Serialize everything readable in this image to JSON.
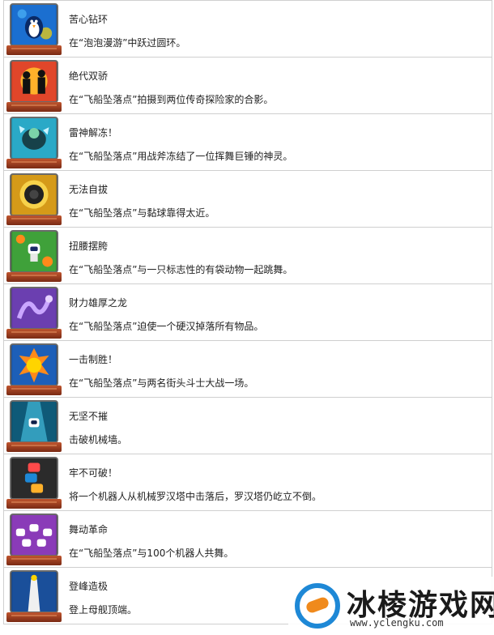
{
  "trophies": [
    {
      "title": "苦心钻环",
      "desc": "在“泡泡漫游”中跃过圆环。",
      "icon": "penguin-trophy-icon",
      "bg": "#1b6fd0"
    },
    {
      "title": "绝代双骄",
      "desc": "在“飞船坠落点”拍摄到两位传奇探险家的合影。",
      "icon": "silhouette-duo-trophy-icon",
      "bg": "#e0462a"
    },
    {
      "title": "雷神解冻！",
      "desc": "在“飞船坠落点”用战斧冻结了一位挥舞巨锤的神灵。",
      "icon": "frozen-god-trophy-icon",
      "bg": "#2aa9c7"
    },
    {
      "title": "无法自拔",
      "desc": "在“飞船坠落点”与黏球靠得太近。",
      "icon": "sticky-ball-trophy-icon",
      "bg": "#d59a19"
    },
    {
      "title": "扭腰摆胯",
      "desc": "在“飞船坠落点”与一只标志性的有袋动物一起跳舞。",
      "icon": "dancing-bot-trophy-icon",
      "bg": "#3fa13a"
    },
    {
      "title": "财力雄厚之龙",
      "desc": "在“飞船坠落点”迫使一个硬汉掉落所有物品。",
      "icon": "dragon-trophy-icon",
      "bg": "#6b3fb0"
    },
    {
      "title": "一击制胜！",
      "desc": "在“飞船坠落点”与两名街头斗士大战一场。",
      "icon": "ko-trophy-icon",
      "bg": "#1d5fb8"
    },
    {
      "title": "无坚不摧",
      "desc": "击破机械墙。",
      "icon": "spotlight-bot-trophy-icon",
      "bg": "#0f5a78"
    },
    {
      "title": "牢不可破！",
      "desc": "将一个机器人从机械罗汉塔中击落后，罗汉塔仍屹立不倒。",
      "icon": "bot-tower-trophy-icon",
      "bg": "#2b2b2b"
    },
    {
      "title": "舞动革命",
      "desc": "在“飞船坠落点”与100个机器人共舞。",
      "icon": "bot-crowd-trophy-icon",
      "bg": "#8a3bb8"
    },
    {
      "title": "登峰造极",
      "desc": "登上母舰顶端。",
      "icon": "tower-top-trophy-icon",
      "bg": "#1a4f9a"
    }
  ],
  "watermark": {
    "name": "冰棱游戏网",
    "url": "www.yclengku.com"
  }
}
